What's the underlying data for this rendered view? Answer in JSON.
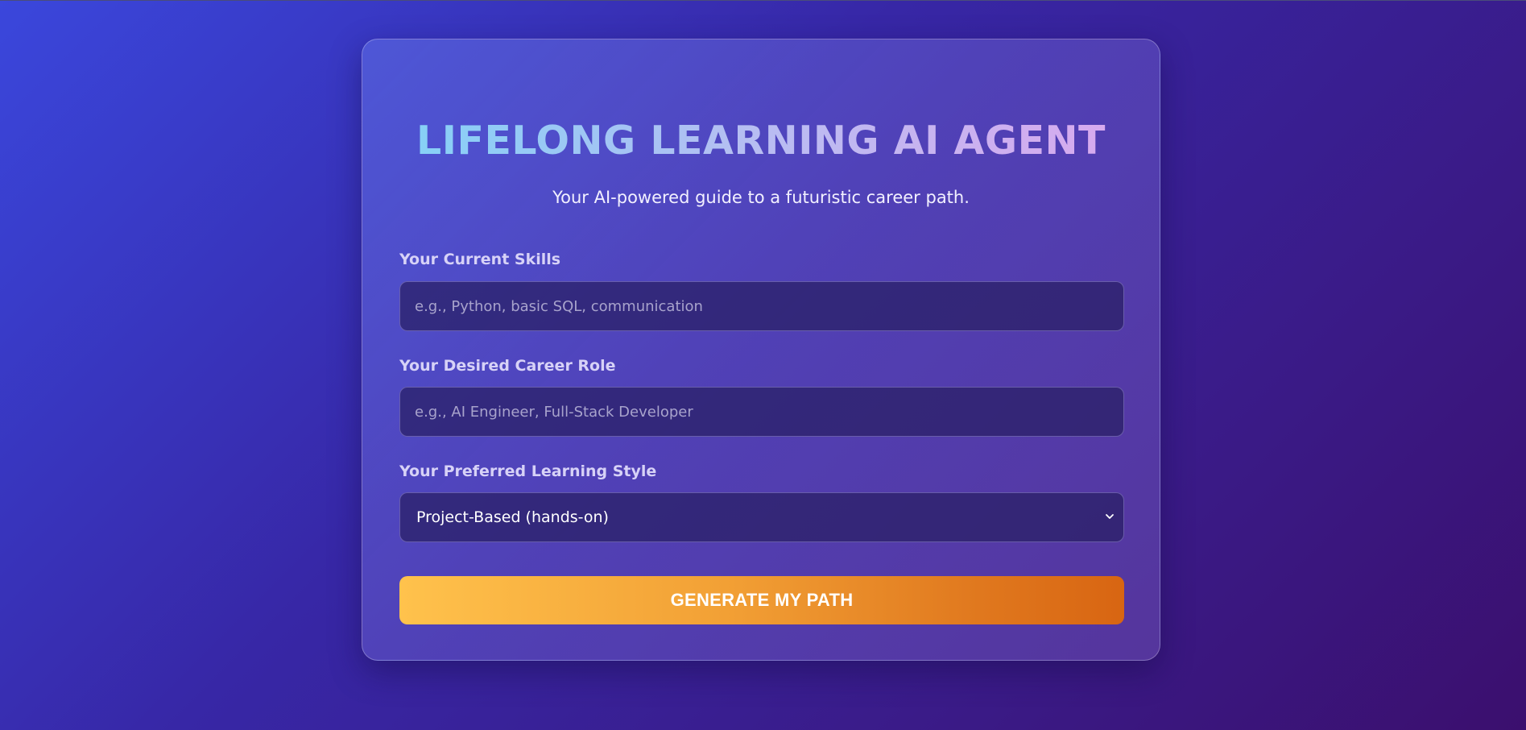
{
  "header": {
    "title": "LIFELONG LEARNING AI AGENT",
    "subtitle": "Your AI-powered guide to a futuristic career path."
  },
  "form": {
    "skills": {
      "label": "Your Current Skills",
      "placeholder": "e.g., Python, basic SQL, communication",
      "value": ""
    },
    "career": {
      "label": "Your Desired Career Role",
      "placeholder": "e.g., AI Engineer, Full-Stack Developer",
      "value": ""
    },
    "style": {
      "label": "Your Preferred Learning Style",
      "selected": "Project-Based (hands-on)"
    },
    "submit_label": "GENERATE MY PATH"
  },
  "colors": {
    "background_start": "#3a47dc",
    "background_end": "#3b0f6e",
    "title_gradient_start": "#7fd3f7",
    "title_gradient_end": "#dca7ee",
    "button_gradient_start": "#ffc24c",
    "button_gradient_end": "#d86512"
  },
  "icons": {
    "select_arrow": "chevron-down-icon"
  }
}
